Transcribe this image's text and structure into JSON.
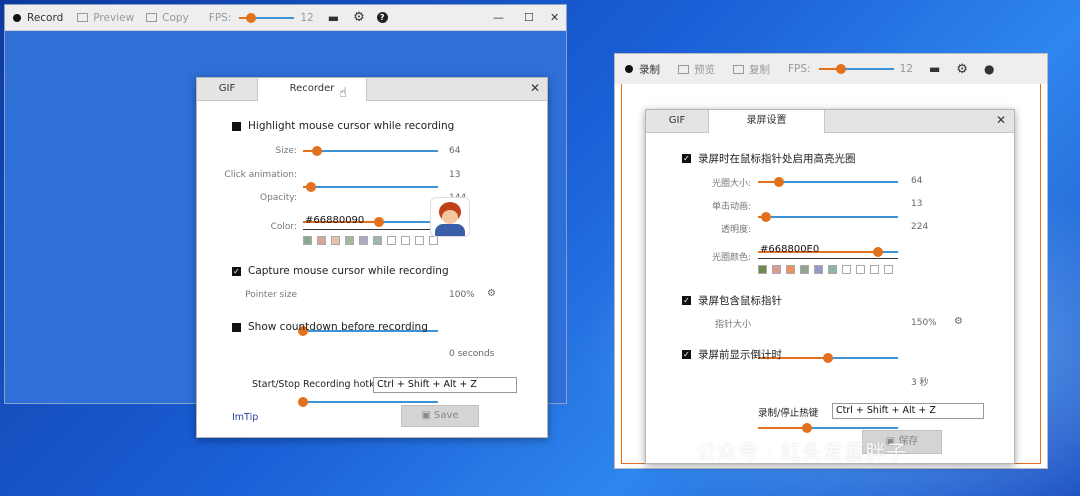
{
  "left_window": {
    "toolbar": {
      "record": "Record",
      "preview": "Preview",
      "copy": "Copy",
      "fps_label": "FPS:",
      "fps_value": "12"
    },
    "fps_fraction": 0.22
  },
  "left_dialog": {
    "tabs": [
      "GIF",
      "Recorder"
    ],
    "close": "✕",
    "highlight_label": "Highlight mouse cursor while recording",
    "size_label": "Size:",
    "size_value": "64",
    "size_frac": 0.1,
    "click_label": "Click animation:",
    "click_value": "13",
    "click_frac": 0.06,
    "opacity_label": "Opacity:",
    "opacity_value": "144",
    "opacity_frac": 0.56,
    "color_label": "Color:",
    "color_value": "#66880090",
    "swatches": [
      "#8aa88a",
      "#d9a59d",
      "#e9c0a8",
      "#a8b89c",
      "#b0a8c6",
      "#9fb8a8",
      "#ffffff",
      "#ffffff",
      "#ffffff",
      "#ffffff"
    ],
    "capture_label": "Capture mouse cursor while recording",
    "pointer_label": "Pointer size",
    "pointer_value": "100%",
    "pointer_frac": 0.0,
    "countdown_label": "Show countdown before recording",
    "countdown_value": "0 seconds",
    "countdown_frac": 0.0,
    "hotkey_label": "Start/Stop Recording hotkey:",
    "hotkey_value": "Ctrl + Shift + Alt + Z",
    "link": "ImTip",
    "save": "Save"
  },
  "right_window": {
    "toolbar": {
      "record": "录制",
      "preview": "预览",
      "copy": "复制",
      "fps_label": "FPS:",
      "fps_value": "12"
    },
    "fps_fraction": 0.3
  },
  "right_dialog": {
    "tabs": [
      "GIF",
      "录屏设置"
    ],
    "close": "✕",
    "highlight_label": "录屏时在鼠标指针处启用高亮光圈",
    "size_label": "光圈大小:",
    "size_value": "64",
    "size_frac": 0.15,
    "click_label": "单击动画:",
    "click_value": "13",
    "click_frac": 0.06,
    "opacity_label": "透明度:",
    "opacity_value": "224",
    "opacity_frac": 0.86,
    "color_label": "光圈颜色:",
    "color_value": "#668800E0",
    "swatches": [
      "#6e8a4e",
      "#d99b92",
      "#e8925c",
      "#8fa590",
      "#9a96c6",
      "#8bb6a2",
      "#ffffff",
      "#ffffff",
      "#ffffff",
      "#ffffff"
    ],
    "capture_label": "录屏包含鼠标指针",
    "pointer_label": "指针大小",
    "pointer_value": "150%",
    "pointer_frac": 0.5,
    "countdown_label": "录屏前显示倒计时",
    "countdown_value": "3 秒",
    "countdown_frac": 0.35,
    "hotkey_label": "录制/停止热键",
    "hotkey_value": "Ctrl + Shift + Alt + Z",
    "save": "保存"
  },
  "watermark": "公众号 · 红头发蓝胖子",
  "colors": {
    "accent": "#e3701c",
    "track": "#3d93d6",
    "desktop": "#1a5fd6"
  }
}
